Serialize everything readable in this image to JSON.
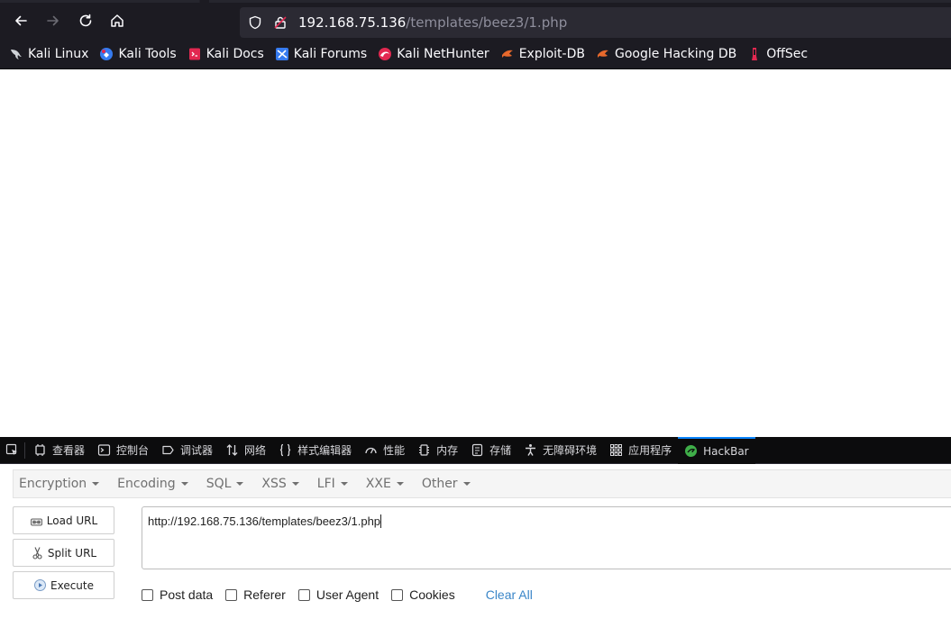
{
  "browser": {
    "url_host": "192.168.75.136",
    "url_path": "/templates/beez3/1.php"
  },
  "bookmarks": [
    {
      "label": "Kali Linux",
      "icon": "kali-dragon-icon"
    },
    {
      "label": "Kali Tools",
      "icon": "kali-tools-icon"
    },
    {
      "label": "Kali Docs",
      "icon": "kali-docs-icon"
    },
    {
      "label": "Kali Forums",
      "icon": "kali-forums-icon"
    },
    {
      "label": "Kali NetHunter",
      "icon": "nethunter-icon"
    },
    {
      "label": "Exploit-DB",
      "icon": "exploit-db-icon"
    },
    {
      "label": "Google Hacking DB",
      "icon": "ghdb-icon"
    },
    {
      "label": "OffSec",
      "icon": "offsec-icon"
    }
  ],
  "devtools": {
    "tabs": [
      {
        "label": "查看器",
        "icon": "inspector-icon"
      },
      {
        "label": "控制台",
        "icon": "console-icon"
      },
      {
        "label": "调试器",
        "icon": "debugger-icon"
      },
      {
        "label": "网络",
        "icon": "network-icon"
      },
      {
        "label": "样式编辑器",
        "icon": "style-editor-icon"
      },
      {
        "label": "性能",
        "icon": "performance-icon"
      },
      {
        "label": "内存",
        "icon": "memory-icon"
      },
      {
        "label": "存储",
        "icon": "storage-icon"
      },
      {
        "label": "无障碍环境",
        "icon": "accessibility-icon"
      },
      {
        "label": "应用程序",
        "icon": "application-icon"
      },
      {
        "label": "HackBar",
        "icon": "hackbar-icon"
      }
    ],
    "active_tab": "HackBar"
  },
  "hackbar": {
    "menu": [
      "Encryption",
      "Encoding",
      "SQL",
      "XSS",
      "LFI",
      "XXE",
      "Other"
    ],
    "buttons": {
      "load": "Load URL",
      "split": "Split URL",
      "execute": "Execute"
    },
    "url_value": "http://192.168.75.136/templates/beez3/1.php",
    "options": [
      "Post data",
      "Referer",
      "User Agent",
      "Cookies"
    ],
    "clear_all": "Clear All"
  },
  "colors": {
    "chrome_bg": "#1c1b22",
    "urlbar_bg": "#2b2a33",
    "devtools_bg": "#0c0c0d",
    "accent": "#0a84ff",
    "link": "#3a86c8"
  }
}
